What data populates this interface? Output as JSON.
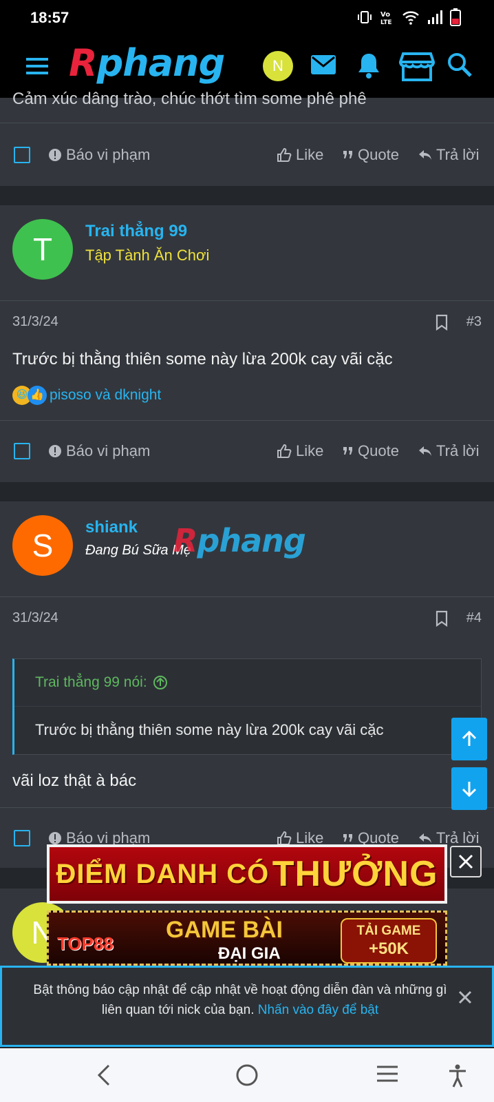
{
  "status_bar": {
    "time": "18:57"
  },
  "header": {
    "logo_r": "R",
    "logo_rest": "phang",
    "user_initial": "N"
  },
  "top_partial_text": "Cảm xúc dâng trào, chúc thớt tìm some phê phê",
  "actions": {
    "report": "Báo vi phạm",
    "like": "Like",
    "quote": "Quote",
    "reply": "Trả lời"
  },
  "posts": [
    {
      "author_initial": "T",
      "author_name": "Trai thẳng 99",
      "author_title": "Tập Tành Ăn Chơi",
      "date": "31/3/24",
      "number": "#3",
      "body": "Trước bị thằng thiên some này lừa 200k cay vãi cặc",
      "reactions": "pisoso và dknight"
    },
    {
      "author_initial": "S",
      "author_name": "shiank",
      "author_title": "Đang Bú Sữa Mẹ",
      "date": "31/3/24",
      "number": "#4",
      "quote_header": "Trai thẳng 99 nói:",
      "quote_text": "Trước bị thằng thiên some này lừa 200k cay vãi cặc",
      "body": "vãi loz thật à bác"
    }
  ],
  "next_post": {
    "author_initial": "N"
  },
  "ads": {
    "banner1_part1": "ĐIỂM DANH CÓ",
    "banner1_part2": "THƯỞNG",
    "banner2_brand": "TOP88",
    "banner2_title": "GAME BÀI",
    "banner2_sub": "ĐẠI GIA",
    "banner2_cta_line1": "TẢI GAME",
    "banner2_cta_line2": "+50K"
  },
  "notification": {
    "text": "Bật thông báo cập nhật để cập nhật về hoạt động diễn đàn và những gì liên quan tới nick của bạn.",
    "link": "Nhấn vào đây để bật"
  },
  "colors": {
    "accent": "#28b4f0",
    "background": "#23262b",
    "panel": "#33373d",
    "title_yellow": "#f0e23c"
  }
}
